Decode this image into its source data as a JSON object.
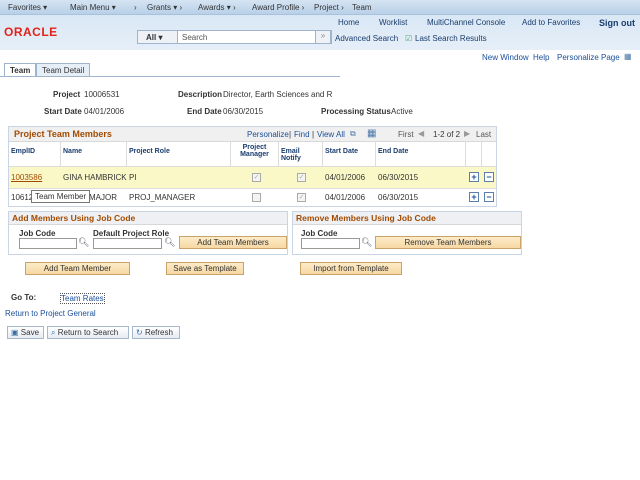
{
  "topnav": {
    "favorites": "Favorites",
    "main_menu": "Main Menu",
    "breadcrumbs": [
      "Grants",
      "Awards",
      "Award Profile",
      "Project",
      "Team"
    ]
  },
  "header": {
    "logo": "ORACLE",
    "links": [
      "Home",
      "Worklist",
      "MultiChannel Console",
      "Add to Favorites",
      "Sign out"
    ],
    "search_scope": "All",
    "search_placeholder": "Search",
    "advanced_search": "Advanced Search",
    "last_search": "Last Search Results"
  },
  "pagelinks": [
    "New Window",
    "Help",
    "Personalize Page"
  ],
  "tabs": [
    "Team",
    "Team Detail"
  ],
  "fields": {
    "project_label": "Project",
    "project": "10006531",
    "desc_label": "Description",
    "desc": "Director, Earth Sciences and R",
    "start_label": "Start Date",
    "start": "04/01/2006",
    "end_label": "End Date",
    "end": "06/30/2015",
    "status_label": "Processing Status",
    "status": "Active"
  },
  "grid": {
    "title": "Project Team Members",
    "tools": [
      "Personalize",
      "Find",
      "View All"
    ],
    "first": "First",
    "range": "1-2 of 2",
    "last": "Last",
    "columns": [
      "EmplID",
      "Name",
      "Project Role",
      "Project Manager",
      "Email Notify",
      "Start Date",
      "End Date"
    ],
    "rows": [
      {
        "emplid": "1003586",
        "name": "GINA HAMBRICK",
        "role": "PI",
        "pm": true,
        "email": true,
        "start": "04/01/2006",
        "end": "06/30/2015"
      },
      {
        "emplid": "10612",
        "name": "MAJOR",
        "role": "PROJ_MANAGER",
        "pm": false,
        "email": true,
        "start": "04/01/2006",
        "end": "06/30/2015"
      }
    ],
    "tooltip": "Team Member"
  },
  "add_box": {
    "title": "Add Members Using Job Code",
    "job_code": "Job Code",
    "role": "Default Project Role",
    "button": "Add Team Members"
  },
  "remove_box": {
    "title": "Remove Members Using Job Code",
    "job_code": "Job Code",
    "button": "Remove Team Members"
  },
  "actions": [
    "Add Team Member",
    "Save as Template",
    "Import from Template"
  ],
  "goto": {
    "label": "Go To:",
    "link": "Team Rates"
  },
  "return_link": "Return to Project General",
  "toolbar": {
    "save": "Save",
    "return": "Return to Search",
    "refresh": "Refresh"
  }
}
